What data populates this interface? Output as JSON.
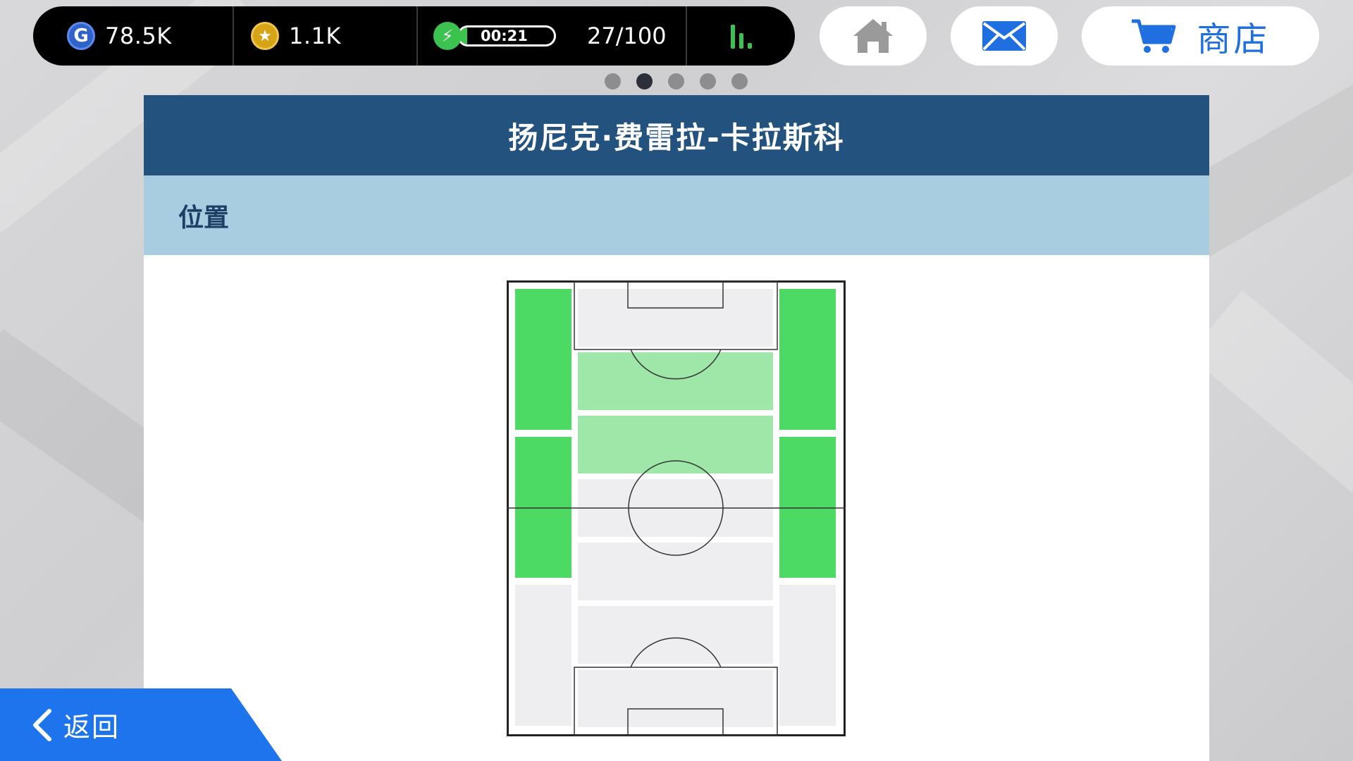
{
  "status_bar": {
    "gp_icon": "G",
    "gp_value": "78.5K",
    "coin_icon": "star-icon",
    "coin_value": "1.1K",
    "energy_timer": "00:21",
    "energy_fraction": 0.08,
    "energy_count": "27/100",
    "colors": {
      "accent_green": "#3cc24f",
      "gp_blue": "#2f63c9",
      "coin_gold": "#d6a416"
    }
  },
  "nav": {
    "home_icon": "home-icon",
    "mail_icon": "mail-icon",
    "shop_icon": "cart-icon",
    "shop_label": "商店"
  },
  "pager": {
    "pages": 5,
    "active_page": 2
  },
  "panel": {
    "title": "扬尼克·费雷拉-卡拉斯科",
    "section_label": "位置",
    "colors": {
      "header": "#23527e",
      "section": "#a8cce0"
    }
  },
  "positions_map": {
    "zones": [
      {
        "id": "left-upper",
        "level": "primary"
      },
      {
        "id": "left-middle",
        "level": "primary"
      },
      {
        "id": "left-lower",
        "level": "none"
      },
      {
        "id": "right-upper",
        "level": "primary"
      },
      {
        "id": "right-middle",
        "level": "primary"
      },
      {
        "id": "right-lower",
        "level": "none"
      },
      {
        "id": "center-1",
        "level": "none"
      },
      {
        "id": "center-2",
        "level": "secondary"
      },
      {
        "id": "center-3",
        "level": "secondary"
      },
      {
        "id": "center-4",
        "level": "none"
      },
      {
        "id": "center-5",
        "level": "none"
      },
      {
        "id": "center-6",
        "level": "none"
      },
      {
        "id": "center-7",
        "level": "none"
      }
    ],
    "colors": {
      "primary": "#4cd964",
      "secondary": "#9fe6a9",
      "none": "#eeeef0"
    }
  },
  "back": {
    "label": "返回"
  }
}
